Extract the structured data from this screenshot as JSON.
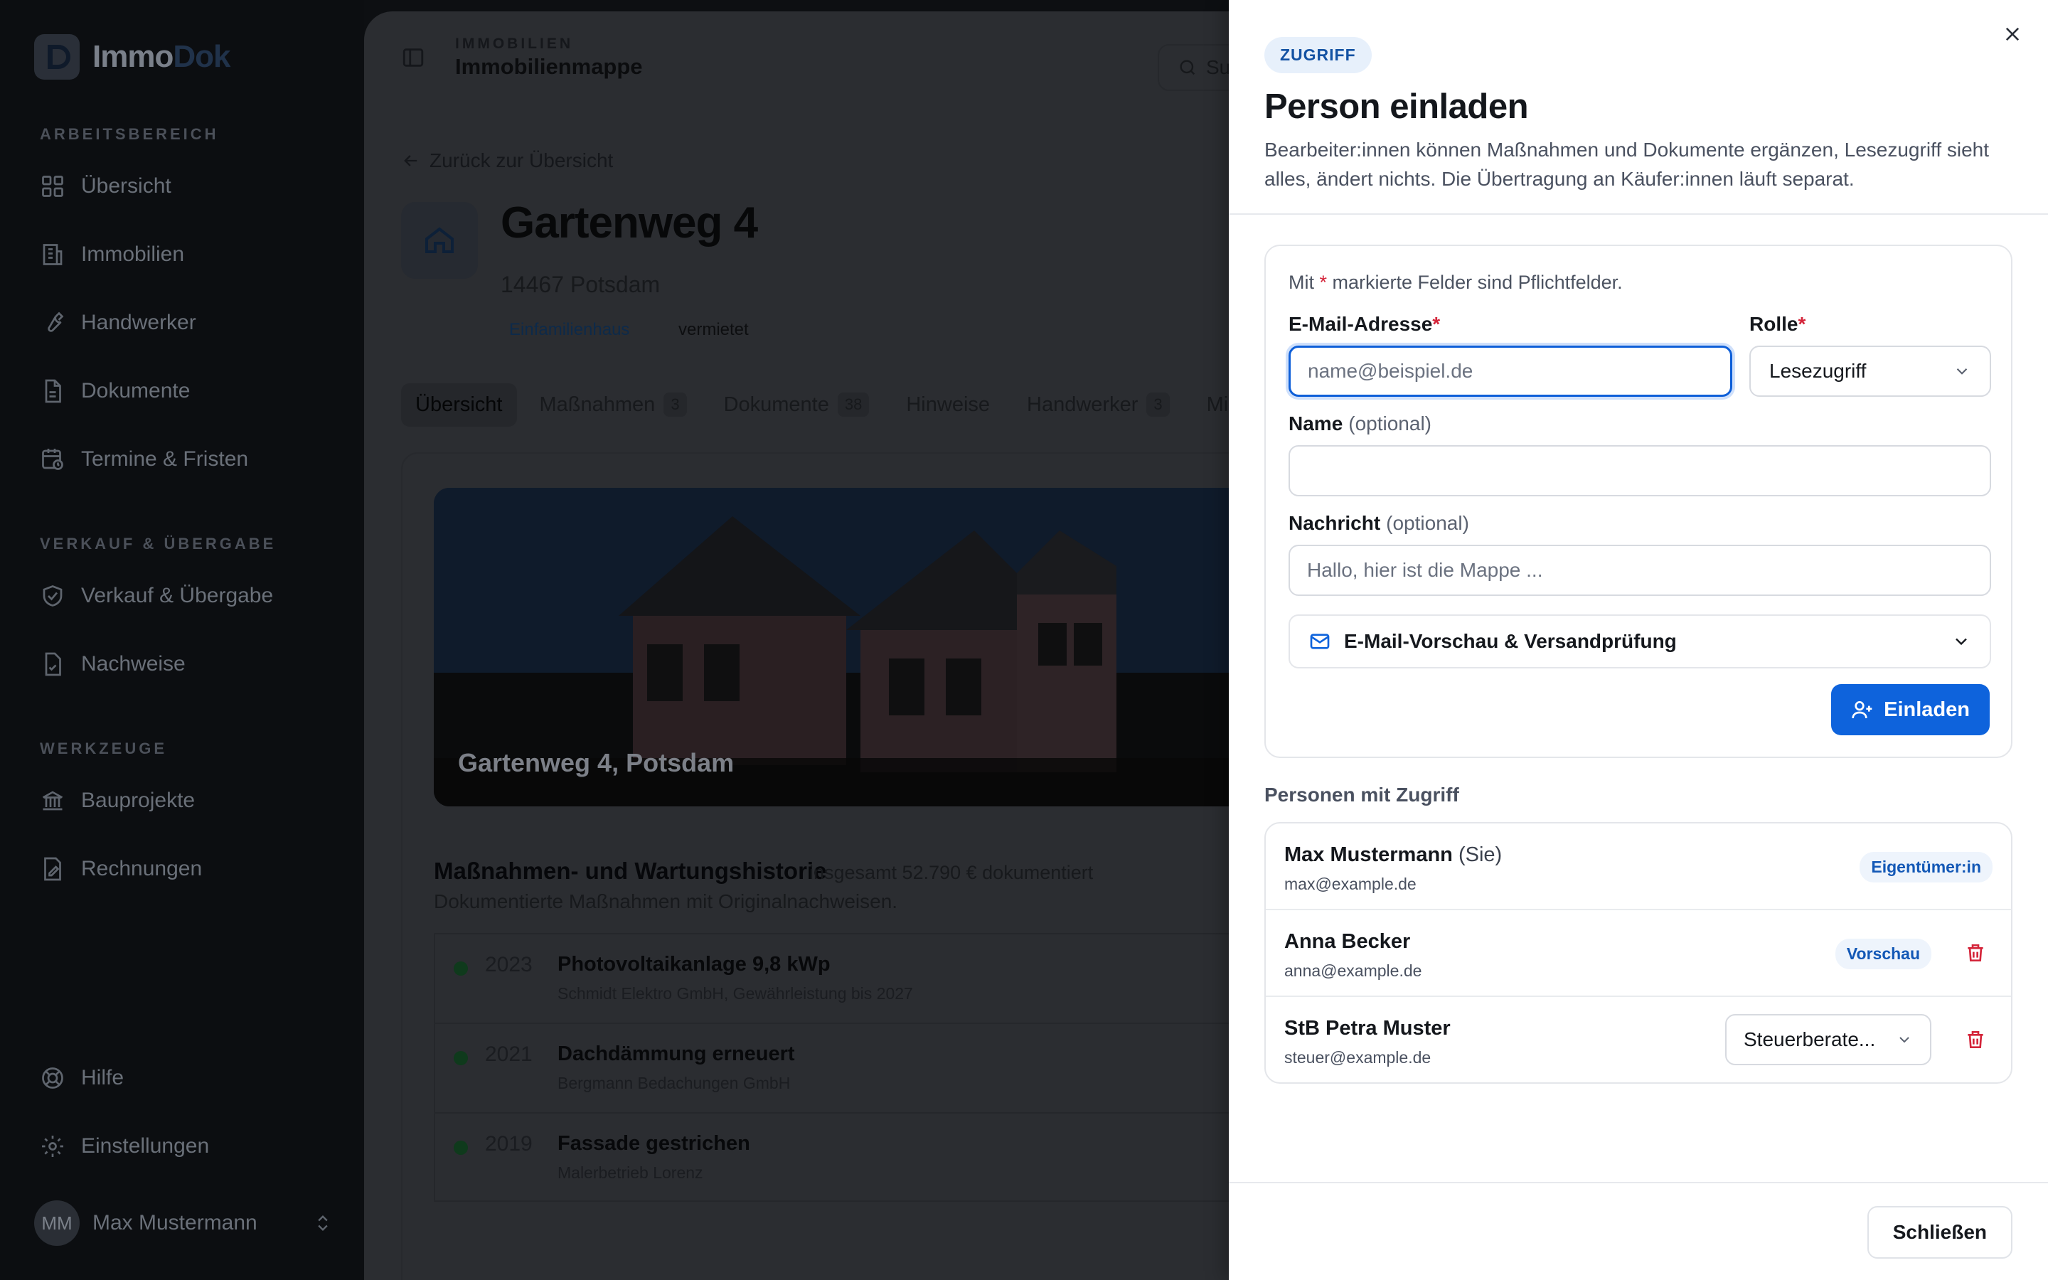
{
  "colors": {
    "accent": "#0e63dc",
    "required": "#d4253a",
    "delete": "#d4253a",
    "badge_bg": "#e7f0fb",
    "badge_text": "#1352a3"
  },
  "sidebar": {
    "logo": {
      "part1": "Immo",
      "part2": "Dok"
    },
    "sections": [
      {
        "title": "ARBEITSBEREICH",
        "items": [
          {
            "label": "Übersicht",
            "icon": "grid-icon"
          },
          {
            "label": "Immobilien",
            "icon": "building-icon"
          },
          {
            "label": "Handwerker",
            "icon": "wrench-icon"
          },
          {
            "label": "Dokumente",
            "icon": "document-icon"
          },
          {
            "label": "Termine & Fristen",
            "icon": "calendar-clock-icon"
          }
        ]
      },
      {
        "title": "VERKAUF & ÜBERGABE",
        "items": [
          {
            "label": "Verkauf & Übergabe",
            "icon": "handshake-icon"
          },
          {
            "label": "Nachweise",
            "icon": "file-check-icon"
          }
        ]
      },
      {
        "title": "WERKZEUGE",
        "items": [
          {
            "label": "Bauprojekte",
            "icon": "bank-icon"
          },
          {
            "label": "Rechnungen",
            "icon": "receipt-icon"
          }
        ]
      }
    ],
    "bottom": [
      {
        "label": "Hilfe",
        "icon": "lifebuoy-icon"
      },
      {
        "label": "Einstellungen",
        "icon": "gear-icon"
      }
    ],
    "user": {
      "initials": "MM",
      "name": "Max Mustermann"
    }
  },
  "main": {
    "kicker": "IMMOBILIEN",
    "title": "Immobilienmappe",
    "search_stub": "Su",
    "back_link": "Zurück zur Übersicht",
    "property": {
      "title": "Gartenweg 4",
      "subtitle": "14467 Potsdam",
      "tags": [
        "Einfamilienhaus",
        "vermietet"
      ]
    },
    "tabs": [
      {
        "label": "Übersicht",
        "count": ""
      },
      {
        "label": "Maßnahmen",
        "count": "3"
      },
      {
        "label": "Dokumente",
        "count": "38"
      },
      {
        "label": "Hinweise",
        "count": ""
      },
      {
        "label": "Handwerker",
        "count": "3"
      },
      {
        "label": "Mietverh",
        "count": ""
      }
    ],
    "hero_caption": "Gartenweg 4, Potsdam",
    "history": {
      "title": "Maßnahmen- und Wartungshistorie",
      "total": "insgesamt 52.790 € dokumentiert",
      "subtitle": "Dokumentierte Maßnahmen mit Originalnachweisen.",
      "items": [
        {
          "year": "2023",
          "name": "Photovoltaikanlage 9,8 kWp",
          "detail": "Schmidt Elektro GmbH, Gewährleistung bis 2027"
        },
        {
          "year": "2021",
          "name": "Dachdämmung erneuert",
          "detail": "Bergmann Bedachungen GmbH"
        },
        {
          "year": "2019",
          "name": "Fassade gestrichen",
          "detail": "Malerbetrieb Lorenz"
        }
      ]
    }
  },
  "drawer": {
    "badge": "ZUGRIFF",
    "title": "Person einladen",
    "description": "Bearbeiter:innen können Maßnahmen und Dokumente ergänzen, Lesezugriff sieht alles, ändert nichts. Die Übertragung an Käufer:innen läuft separat.",
    "form": {
      "required_hint_pre": "Mit ",
      "required_hint_star": "*",
      "required_hint_post": " markierte Felder sind Pflichtfelder.",
      "email_label": "E-Mail-Adresse",
      "email_placeholder": "name@beispiel.de",
      "email_value": "",
      "role_label": "Rolle",
      "role_value": "Lesezugriff",
      "name_label": "Name",
      "name_optional": "(optional)",
      "name_value": "",
      "message_label": "Nachricht",
      "message_optional": "(optional)",
      "message_placeholder": "Hallo, hier ist die Mappe ...",
      "preview_label": "E-Mail-Vorschau & Versandprüfung",
      "invite_button": "Einladen"
    },
    "people_title": "Personen mit Zugriff",
    "people": [
      {
        "name": "Max Mustermann",
        "suffix": "(Sie)",
        "email": "max@example.de",
        "role": "Eigentümer:in",
        "role_kind": "pill",
        "deletable": false
      },
      {
        "name": "Anna Becker",
        "suffix": "",
        "email": "anna@example.de",
        "role": "Vorschau",
        "role_kind": "pill",
        "deletable": true
      },
      {
        "name": "StB Petra Muster",
        "suffix": "",
        "email": "steuer@example.de",
        "role": "Steuerberate...",
        "role_kind": "select",
        "deletable": true
      }
    ],
    "close_button": "Schließen"
  }
}
